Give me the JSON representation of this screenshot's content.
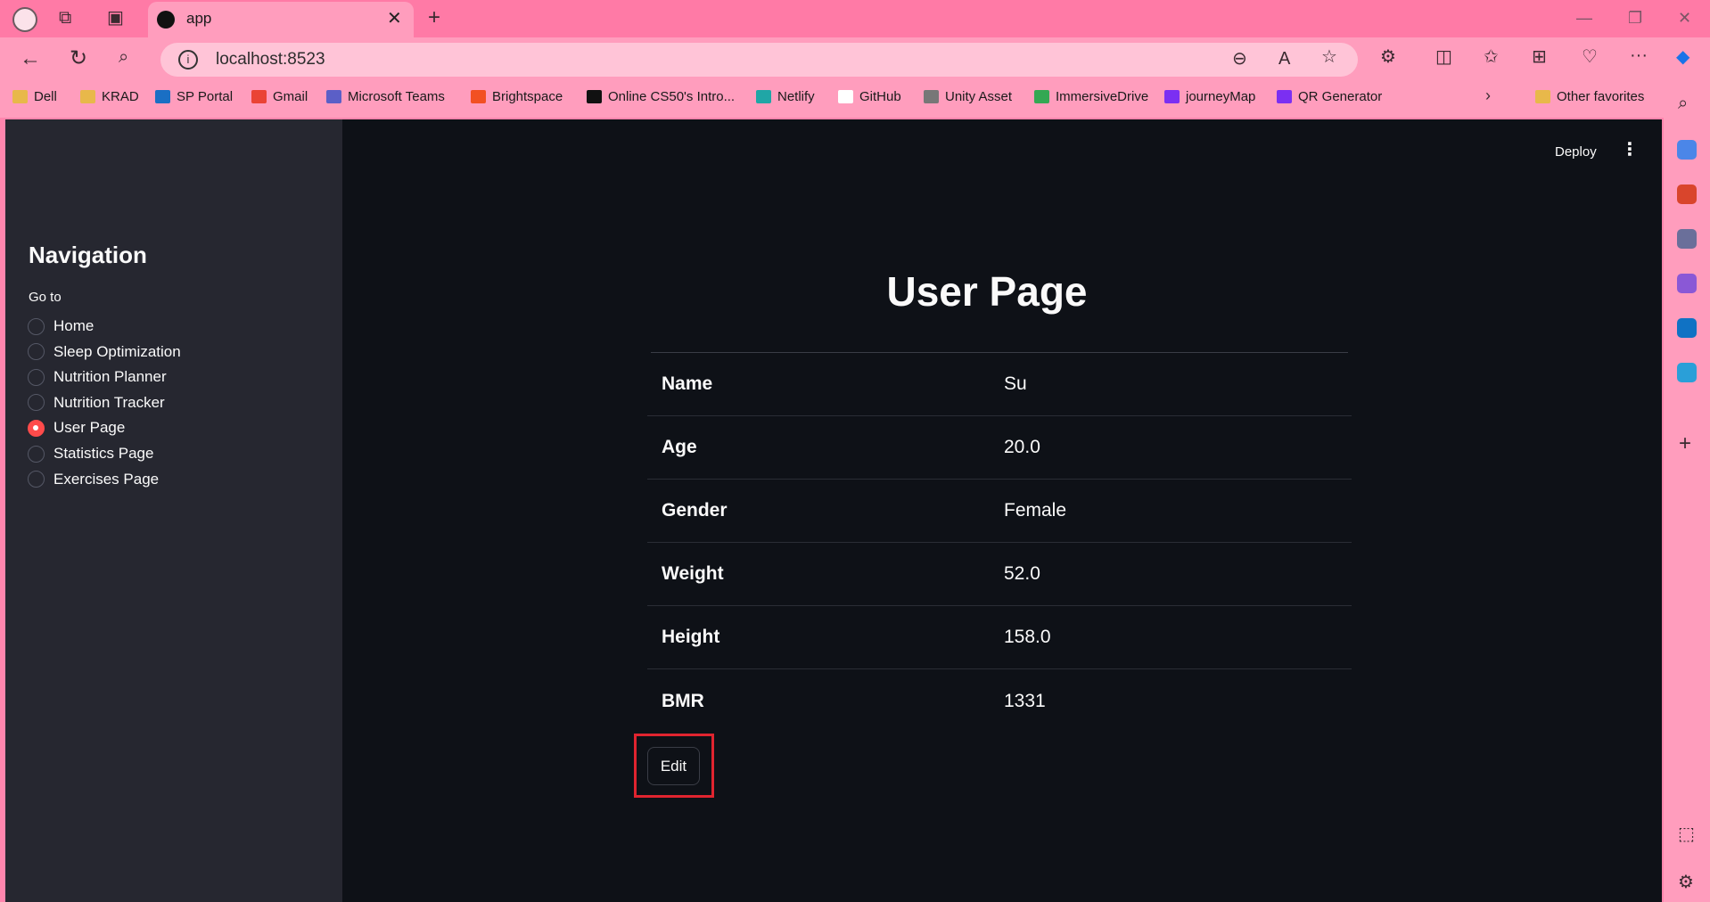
{
  "browser": {
    "tab_title": "app",
    "url": "localhost:8523",
    "bookmarks": [
      {
        "label": "Dell",
        "color": "#e8b84a"
      },
      {
        "label": "KRAD",
        "color": "#e8b84a"
      },
      {
        "label": "SP Portal",
        "color": "#1a6fc4"
      },
      {
        "label": "Gmail",
        "color": "#ea4335"
      },
      {
        "label": "Microsoft Teams",
        "color": "#5b5fc7"
      },
      {
        "label": "Brightspace",
        "color": "#f25022"
      },
      {
        "label": "Online CS50's Intro...",
        "color": "#111111"
      },
      {
        "label": "Netlify",
        "color": "#20a6a6"
      },
      {
        "label": "GitHub",
        "color": "#ffffff"
      },
      {
        "label": "Unity Asset",
        "color": "#777777"
      },
      {
        "label": "ImmersiveDrive",
        "color": "#34a853"
      },
      {
        "label": "journeyMap",
        "color": "#7b2ff2"
      },
      {
        "label": "QR Generator",
        "color": "#7b2ff2"
      }
    ],
    "other_favorites": "Other favorites"
  },
  "app": {
    "deploy_label": "Deploy",
    "sidebar": {
      "title": "Navigation",
      "radio_label": "Go to",
      "options": [
        "Home",
        "Sleep Optimization",
        "Nutrition Planner",
        "Nutrition Tracker",
        "User Page",
        "Statistics Page",
        "Exercises Page"
      ],
      "selected": "User Page"
    },
    "page_title": "User Page",
    "user_table": [
      {
        "key": "Name",
        "value": "Su"
      },
      {
        "key": "Age",
        "value": "20.0"
      },
      {
        "key": "Gender",
        "value": "Female"
      },
      {
        "key": "Weight",
        "value": "52.0"
      },
      {
        "key": "Height",
        "value": "158.0"
      },
      {
        "key": "BMR",
        "value": "1331"
      }
    ],
    "edit_label": "Edit",
    "accent_color": "#ff4b4b"
  }
}
